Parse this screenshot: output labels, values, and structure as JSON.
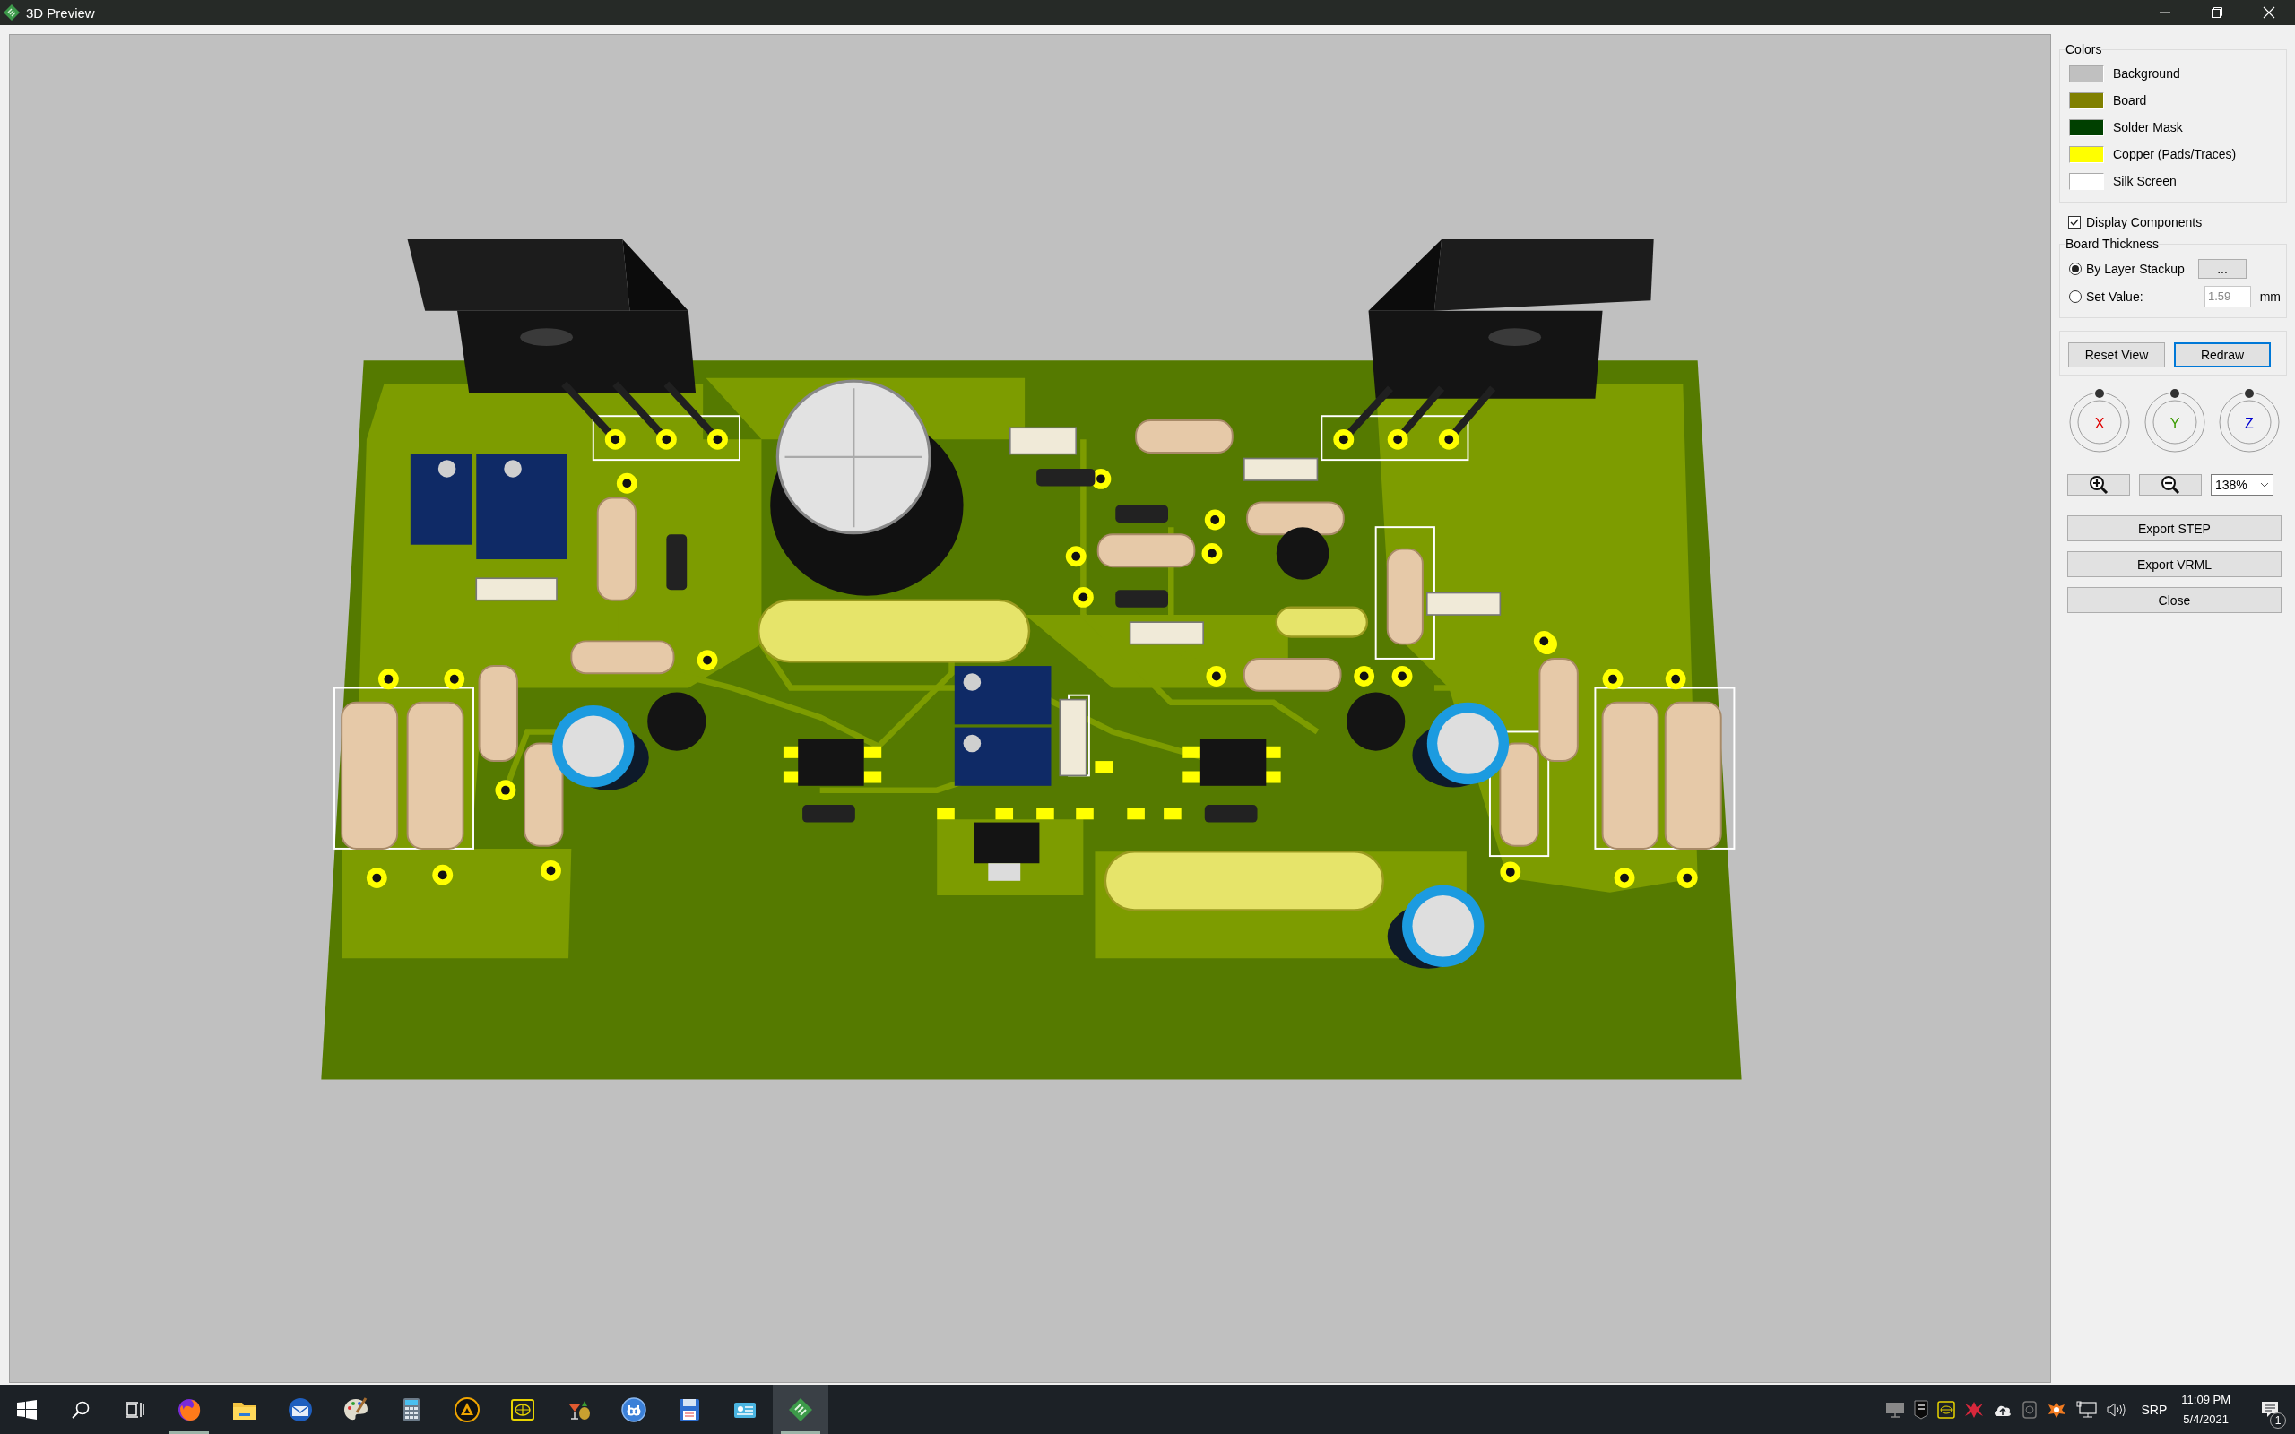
{
  "window": {
    "title": "3D Preview"
  },
  "colors": {
    "title": "Colors",
    "items": [
      {
        "label": "Background",
        "color": "#c0c0c0"
      },
      {
        "label": "Board",
        "color": "#808000"
      },
      {
        "label": "Solder Mask",
        "color": "#004000"
      },
      {
        "label": "Copper (Pads/Traces)",
        "color": "#ffff00"
      },
      {
        "label": "Silk Screen",
        "color": "#ffffff"
      }
    ]
  },
  "display_components": {
    "label": "Display Components",
    "checked": true
  },
  "board_thickness": {
    "title": "Board Thickness",
    "options": [
      {
        "kind": "stackup",
        "label": "By Layer Stackup",
        "selected": true,
        "button": "..."
      },
      {
        "kind": "value",
        "label": "Set Value:",
        "selected": false,
        "value": "1.59",
        "unit": "mm",
        "disabled": true
      }
    ]
  },
  "view_buttons": [
    {
      "label": "Reset View",
      "default": false
    },
    {
      "label": "Redraw",
      "default": true
    }
  ],
  "rotation_dials": [
    {
      "axis": "X",
      "color": "#e00000"
    },
    {
      "axis": "Y",
      "color": "#3a9a00"
    },
    {
      "axis": "Z",
      "color": "#0000d0"
    }
  ],
  "zoom": {
    "value": "138%"
  },
  "actions": [
    "Export STEP",
    "Export VRML",
    "Close"
  ],
  "taskbar": {
    "apps": [
      {
        "kind": "browser",
        "running": true,
        "active": false
      },
      {
        "kind": "folder",
        "running": false,
        "active": false
      },
      {
        "kind": "mail",
        "running": false,
        "active": false
      },
      {
        "kind": "paint",
        "running": false,
        "active": false
      },
      {
        "kind": "calculator",
        "running": false,
        "active": false
      },
      {
        "kind": "player",
        "running": false,
        "active": false
      },
      {
        "kind": "globe",
        "running": false,
        "active": false
      },
      {
        "kind": "cocktail",
        "running": false,
        "active": false
      },
      {
        "kind": "torrent",
        "running": false,
        "active": false
      },
      {
        "kind": "floppy",
        "running": false,
        "active": false
      },
      {
        "kind": "card",
        "running": false,
        "active": false
      },
      {
        "kind": "pcb",
        "running": true,
        "active": true
      }
    ],
    "tray": {
      "language": "SRP",
      "time": "11:09 PM",
      "date": "5/4/2021",
      "notifications": "1"
    }
  }
}
